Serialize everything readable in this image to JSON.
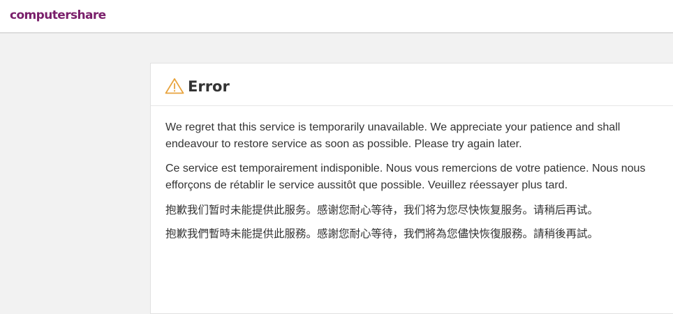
{
  "header": {
    "logo_text": "computershare"
  },
  "error": {
    "title": "Error",
    "icon": "warning-triangle-icon",
    "messages": {
      "en": "We regret that this service is temporarily unavailable. We appreciate your patience and shall endeavour to restore service as soon as possible. Please try again later.",
      "fr": "Ce service est temporairement indisponible. Nous vous remercions de votre patience. Nous nous efforçons de rétablir le service aussitôt que possible. Veuillez réessayer plus tard.",
      "zh_hans": "抱歉我们暂时未能提供此服务。感谢您耐心等待，我们将为您尽快恢复服务。请稍后再试。",
      "zh_hant": "抱歉我們暫時未能提供此服務。感謝您耐心等待，我們將為您儘快恢復服務。請稍後再試。"
    }
  },
  "colors": {
    "brand": "#7a1f6b",
    "warning": "#e8a33d",
    "background": "#f2f2f2"
  }
}
